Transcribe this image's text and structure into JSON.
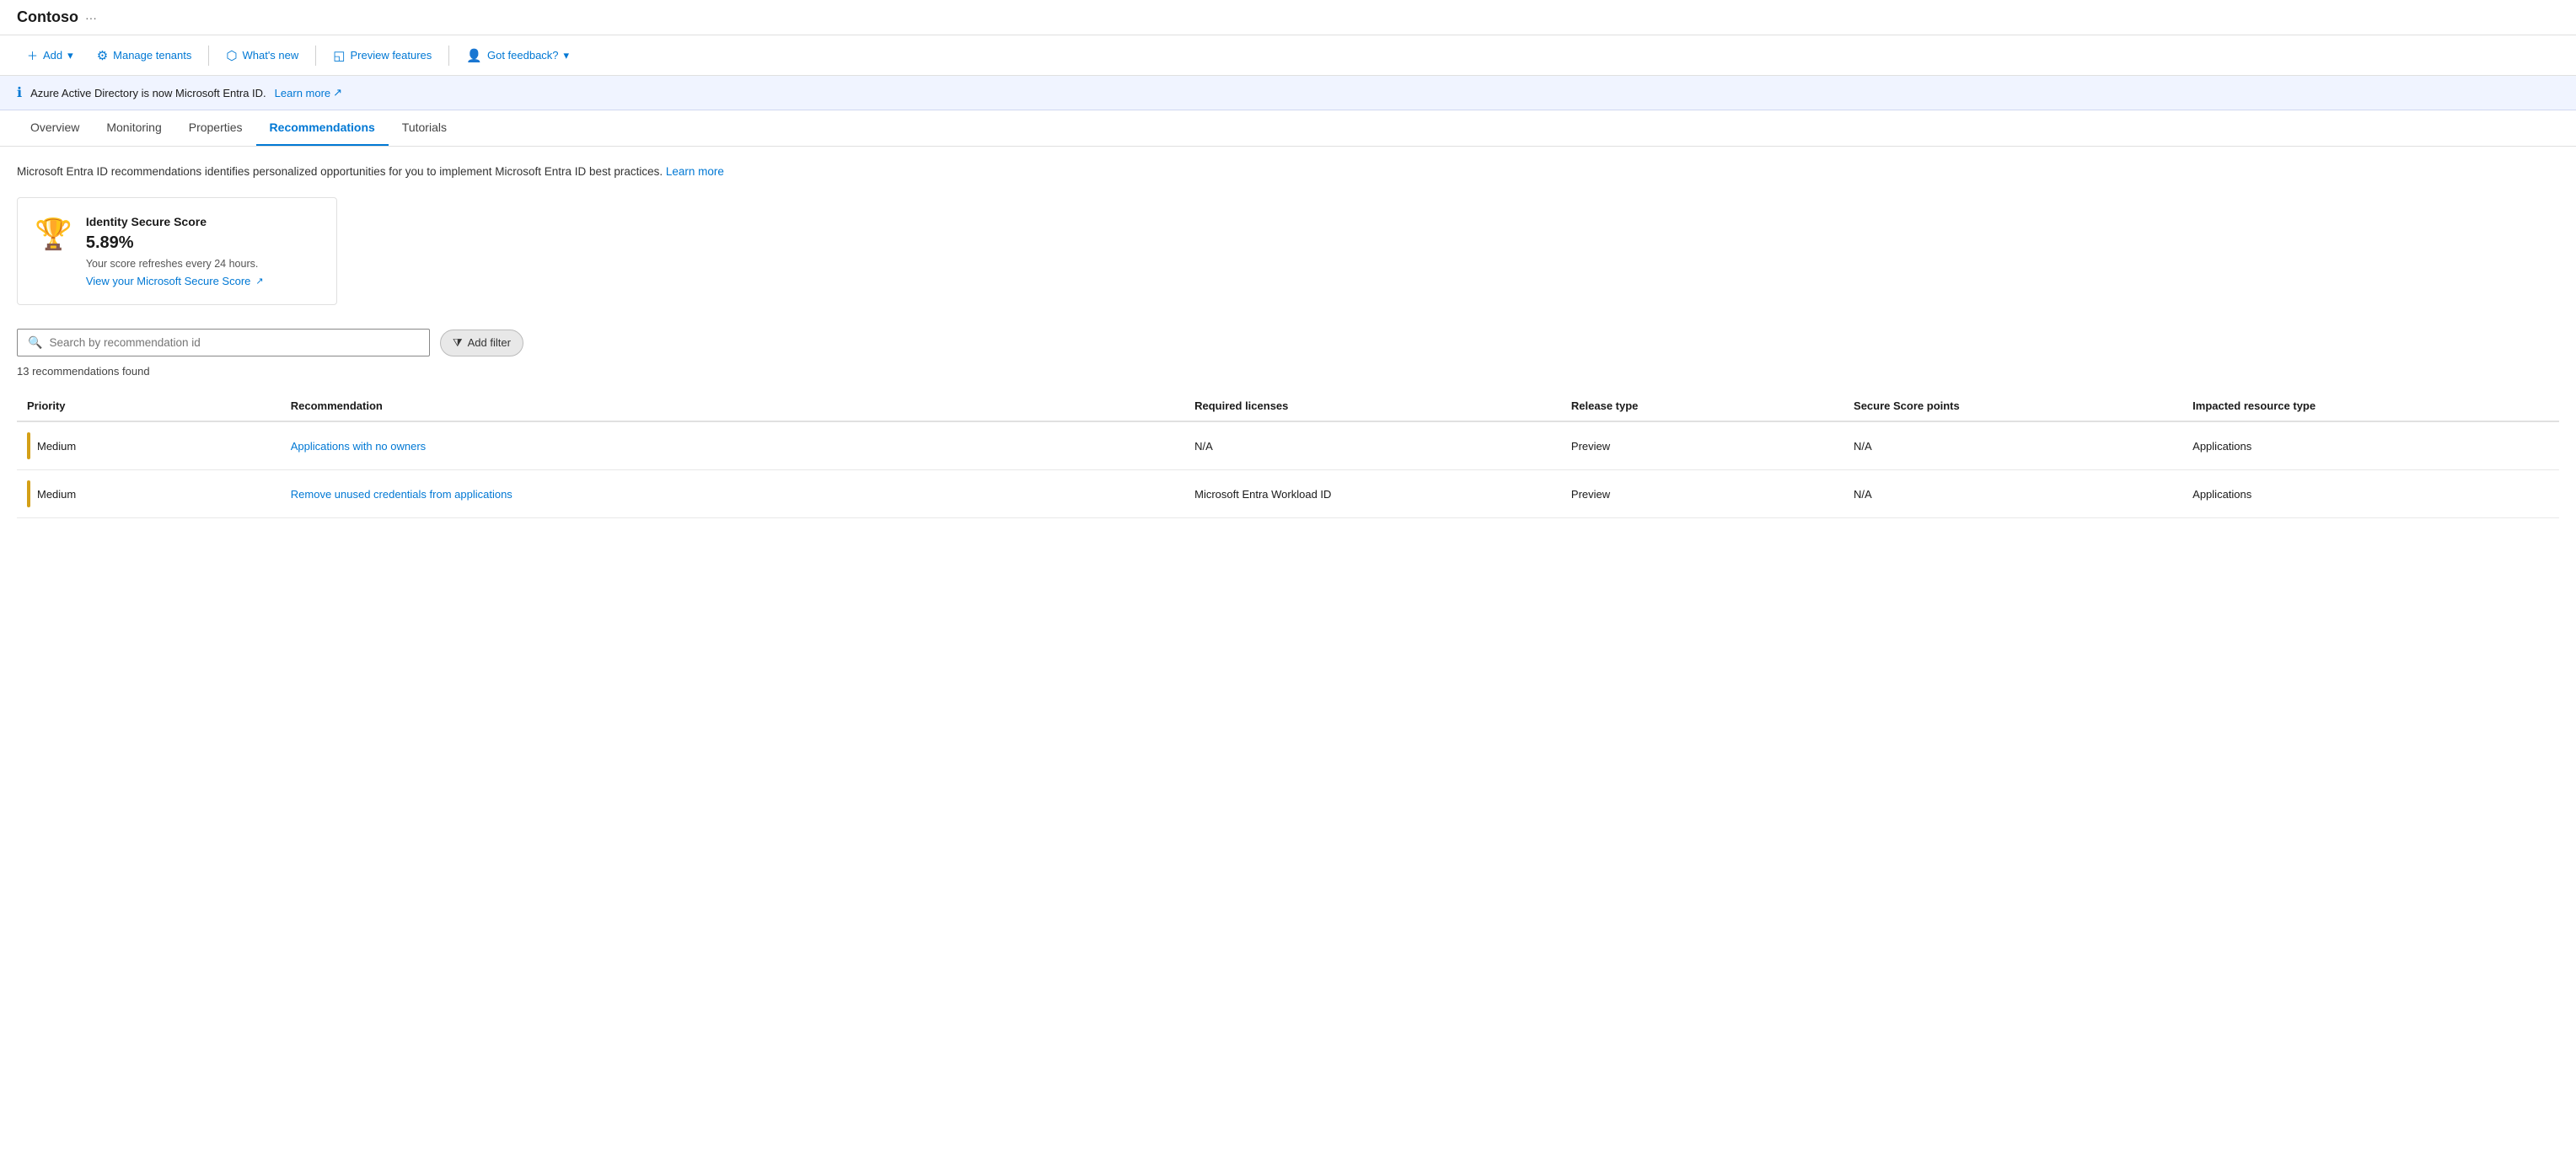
{
  "app": {
    "title": "Contoso",
    "ellipsis": "···"
  },
  "toolbar": {
    "add_label": "Add",
    "manage_tenants_label": "Manage tenants",
    "whats_new_label": "What's new",
    "preview_features_label": "Preview features",
    "got_feedback_label": "Got feedback?"
  },
  "banner": {
    "text": "Azure Active Directory is now Microsoft Entra ID.",
    "link_text": "Learn more",
    "link_icon": "↗"
  },
  "tabs": {
    "items": [
      {
        "label": "Overview",
        "active": false
      },
      {
        "label": "Monitoring",
        "active": false
      },
      {
        "label": "Properties",
        "active": false
      },
      {
        "label": "Recommendations",
        "active": true
      },
      {
        "label": "Tutorials",
        "active": false
      }
    ]
  },
  "content": {
    "description": "Microsoft Entra ID recommendations identifies personalized opportunities for you to implement Microsoft Entra ID best practices.",
    "description_link": "Learn more",
    "score_card": {
      "title": "Identity Secure Score",
      "score": "5.89%",
      "refresh_text": "Your score refreshes every 24 hours.",
      "view_link": "View your Microsoft Secure Score",
      "view_link_icon": "↗"
    },
    "search_placeholder": "Search by recommendation id",
    "filter_button": "Add filter",
    "results_count": "13 recommendations found",
    "table": {
      "headers": [
        {
          "label": "Priority"
        },
        {
          "label": "Recommendation"
        },
        {
          "label": "Required licenses"
        },
        {
          "label": "Release type"
        },
        {
          "label": "Secure Score points"
        },
        {
          "label": "Impacted resource type"
        }
      ],
      "rows": [
        {
          "priority": "Medium",
          "recommendation": "Applications with no owners",
          "licenses": "N/A",
          "release_type": "Preview",
          "score_points": "N/A",
          "resource_type": "Applications"
        },
        {
          "priority": "Medium",
          "recommendation": "Remove unused credentials from applications",
          "licenses": "Microsoft Entra Workload ID",
          "release_type": "Preview",
          "score_points": "N/A",
          "resource_type": "Applications"
        }
      ]
    }
  }
}
